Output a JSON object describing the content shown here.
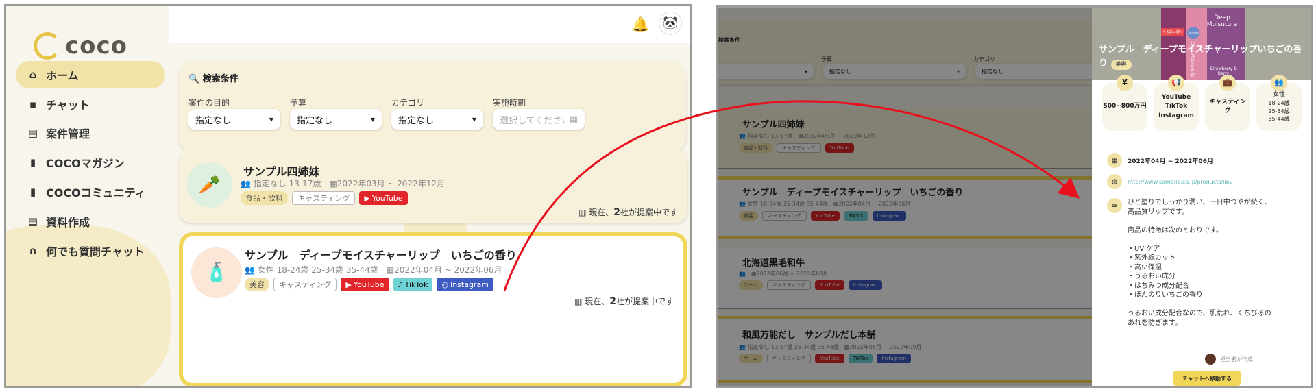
{
  "app": {
    "logo": "coco",
    "nav": [
      {
        "label": "ホーム",
        "icon": "home-icon"
      },
      {
        "label": "チャット",
        "icon": "chat-icon"
      },
      {
        "label": "案件管理",
        "icon": "list-icon"
      },
      {
        "label": "COCOマガジン",
        "icon": "document-icon"
      },
      {
        "label": "COCOコミュニティ",
        "icon": "document-icon"
      },
      {
        "label": "資料作成",
        "icon": "file-icon"
      },
      {
        "label": "何でも質問チャット",
        "icon": "headset-icon"
      }
    ]
  },
  "search": {
    "title": "検索条件",
    "fields": [
      {
        "label": "案件の目的",
        "value": "指定なし"
      },
      {
        "label": "予算",
        "value": "指定なし"
      },
      {
        "label": "カテゴリ",
        "value": "指定なし"
      },
      {
        "label": "実施時期",
        "placeholder": "選択してください"
      }
    ]
  },
  "projects": [
    {
      "title": "サンプル四姉妹",
      "target": "指定なし 13-17歳",
      "period": "2022年03月 ~ 2022年12月",
      "category": "食品・飲料",
      "type": "キャスティング",
      "platforms": [
        "YouTube"
      ],
      "proposal_prefix": "現在、",
      "proposal_count": "2",
      "proposal_suffix": "社が提案中です"
    },
    {
      "title": "サンプル　ディープモイスチャーリップ　いちごの香り",
      "target": "女性 18-24歳 25-34歳 35-44歳",
      "period": "2022年04月 ~ 2022年06月",
      "category": "美容",
      "type": "キャスティング",
      "platforms": [
        "YouTube",
        "TikTok",
        "Instagram"
      ],
      "proposal_prefix": "現在、",
      "proposal_count": "2",
      "proposal_suffix": "社が提案中です"
    },
    {
      "title": "北海道黒毛和牛",
      "target": "",
      "period": "2022年06月 ~ 2022年09月",
      "category": "ゲーム",
      "type": "キャスティング",
      "platforms": [
        "YouTube",
        "Instagram"
      ]
    },
    {
      "title": "和風万能だし　サンプルだし本舗",
      "target": "指定なし 13-17歳 25-34歳 35-44歳",
      "period": "2022年06月 ~ 2022年09月",
      "category": "ゲーム",
      "type": "キャスティング",
      "platforms": [
        "YouTube",
        "TikTok",
        "Instagram"
      ]
    }
  ],
  "detail": {
    "title": "サンプル　ディープモイスチャーリップいちごの香り",
    "category": "美容",
    "image_text": {
      "brand": "Sample",
      "headline": "Deep Moisuture",
      "flavor": "Strawberry & Berry",
      "tagline": "うるおい続く",
      "product": "Deep Moisture lip"
    },
    "stats": {
      "budget": "500~800万円",
      "platforms": [
        "YouTube",
        "TikTok",
        "Instagram"
      ],
      "type": "キャスティング",
      "gender": "女性",
      "ages": [
        "18-24歳",
        "25-34歳",
        "35-44歳"
      ]
    },
    "period": "2022年04月 ~ 2022年06月",
    "url": "http://www.sampile.co.jp/products/lip2",
    "description": [
      "ひと塗りでしっかり潤い、一日中つやが続く、",
      "高品質リップです。",
      "",
      "商品の特徴は次のとおりです。",
      "",
      "・UV ケア",
      "・紫外線カット",
      "・高い保湿",
      "・うるおい成分",
      "・はちみつ成分配合",
      "・ほんのりいちごの香り",
      "",
      "うるおい成分配合なので、肌荒れ、くちびるの",
      "あれを防ぎます。"
    ],
    "author": "担当者が作成",
    "chat_button": "チャットへ移動する"
  },
  "colors": {
    "accent": "#f1e2a8",
    "yellow": "#f2d65a",
    "arrow": "#e8101c",
    "youtube": "#e0262b",
    "tiktok": "#6fd3d6",
    "instagram": "#3d5bc0"
  }
}
